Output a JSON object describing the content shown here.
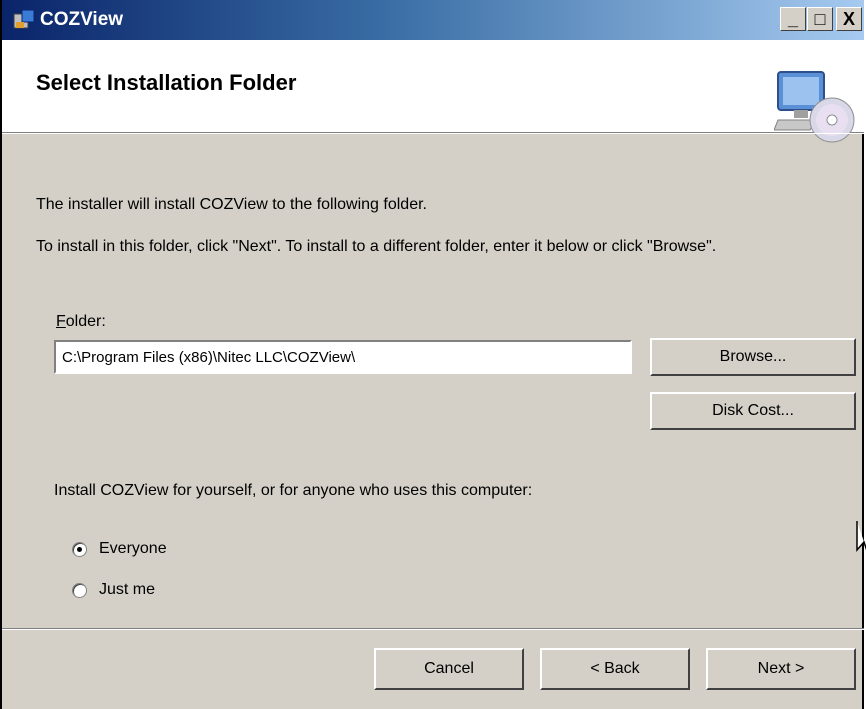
{
  "window": {
    "title": "COZView",
    "minimize": "_",
    "maximize": "□",
    "close": "X",
    "icon": "installer-icon"
  },
  "header": {
    "title": "Select Installation Folder",
    "icon": "computer-cd-icon"
  },
  "body": {
    "intro": "The installer will install COZView to the following folder.",
    "instructions": "To install in this folder, click \"Next\". To install to a different folder, enter it below or click \"Browse\"."
  },
  "folder": {
    "label_accel": "F",
    "label_rest": "older:",
    "value": "C:\\Program Files (x86)\\Nitec LLC\\COZView\\"
  },
  "buttons": {
    "browse": "Browse...",
    "disk_cost": "Disk Cost...",
    "cancel": "Cancel",
    "back": "< Back",
    "next": "Next >"
  },
  "scope": {
    "question": "Install COZView for yourself, or for anyone who uses this computer:",
    "options": [
      {
        "label": "Everyone",
        "checked": true
      },
      {
        "label": "Just me",
        "checked": false
      }
    ]
  }
}
